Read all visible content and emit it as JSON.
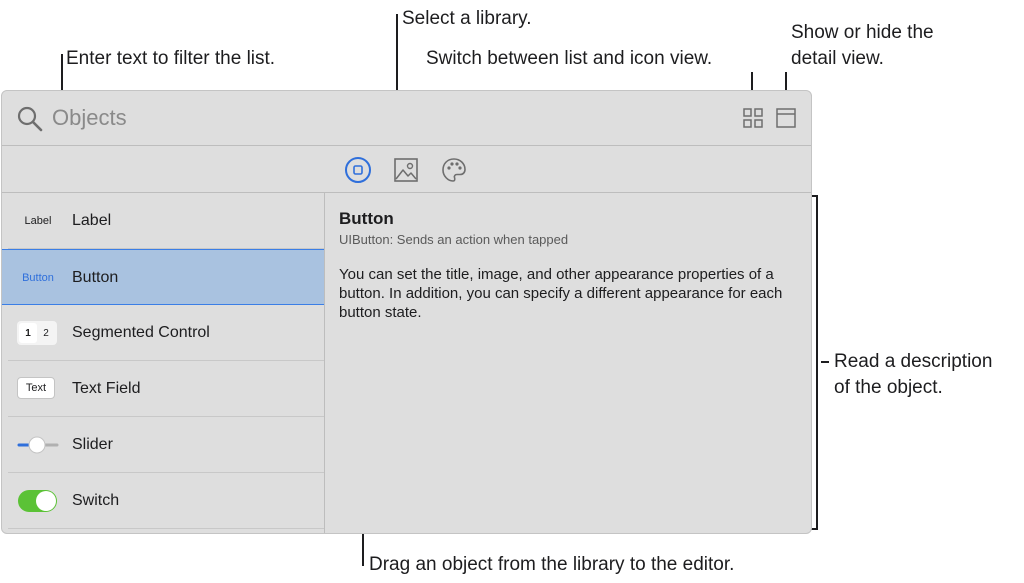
{
  "callouts": {
    "select_library": "Select a library.",
    "filter": "Enter text to filter the list.",
    "switch_view": "Switch between list and icon view.",
    "detail_toggle_line1": "Show or hide the",
    "detail_toggle_line2": "detail view.",
    "read_desc_line1": "Read a description",
    "read_desc_line2": "of the object.",
    "drag_object": "Drag an object from the library to the editor."
  },
  "search": {
    "placeholder": "Objects",
    "icon": "magnifying-glass"
  },
  "toolbar": {
    "icons": [
      "grid-view-icon",
      "detail-panel-icon"
    ]
  },
  "library_tabs": [
    {
      "icon": "objects-library-icon",
      "selected": true
    },
    {
      "icon": "media-library-icon",
      "selected": false
    },
    {
      "icon": "color-library-icon",
      "selected": false
    }
  ],
  "objects": [
    {
      "name": "Label",
      "thumb_text": "Label",
      "thumb": "label"
    },
    {
      "name": "Button",
      "thumb_text": "Button",
      "thumb": "button",
      "selected": true
    },
    {
      "name": "Segmented Control",
      "thumb_seg1": "1",
      "thumb_seg2": "2",
      "thumb": "segmented"
    },
    {
      "name": "Text Field",
      "thumb_text": "Text",
      "thumb": "textfield"
    },
    {
      "name": "Slider",
      "thumb": "slider"
    },
    {
      "name": "Switch",
      "thumb": "switch"
    }
  ],
  "detail": {
    "title": "Button",
    "subtitle": "UIButton: Sends an action when tapped",
    "body": "You can set the title, image, and other appearance properties of a button. In addition, you can specify a different appearance for each button state."
  },
  "colors": {
    "accent": "#3b7ee6",
    "selection": "#a9c2e0",
    "panel": "#dedede",
    "switch_on": "#5bc236"
  }
}
